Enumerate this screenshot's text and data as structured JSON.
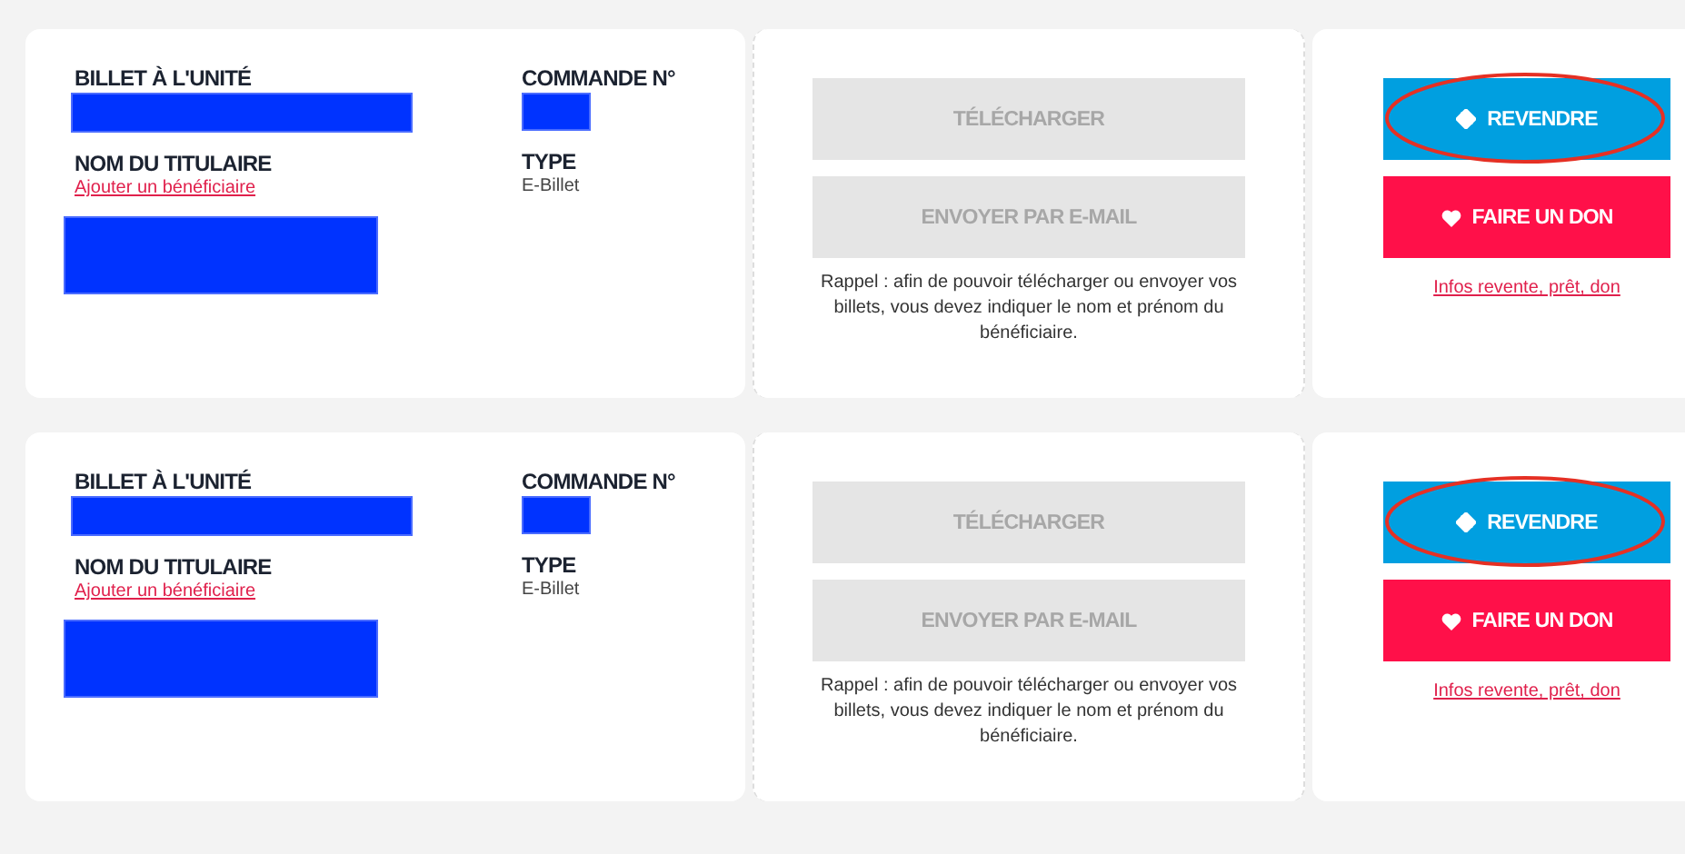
{
  "tickets": [
    {
      "columns": [
        [
          {
            "kind": "label",
            "text": "BILLET À L'UNITÉ"
          },
          {
            "kind": "redaction"
          },
          {
            "kind": "label",
            "text": "NOM DU TITULAIRE"
          },
          {
            "kind": "link",
            "text": "Ajouter un bénéficiaire"
          },
          {
            "kind": "redaction"
          }
        ],
        [
          {
            "kind": "label",
            "text": "COMMANDE N°"
          },
          {
            "kind": "redaction"
          },
          {
            "kind": "label",
            "text": "TYPE"
          },
          {
            "kind": "text",
            "text": "E-Billet"
          }
        ]
      ],
      "actions": [
        {
          "label": "TÉLÉCHARGER",
          "disabled": true
        },
        {
          "label": "ENVOYER PAR E-MAIL",
          "disabled": true
        }
      ],
      "reminder": "Rappel : afin de pouvoir télécharger ou envoyer vos billets, vous devez indiquer le nom et prénom du bénéficiaire.",
      "side_buttons": [
        {
          "kind": "resell",
          "label": "REVENDRE",
          "highlighted": true
        },
        {
          "kind": "donate",
          "label": "FAIRE UN DON",
          "highlighted": false
        }
      ],
      "info_link": "Infos revente, prêt, don"
    },
    {
      "columns": [
        [
          {
            "kind": "label",
            "text": "BILLET À L'UNITÉ"
          },
          {
            "kind": "redaction"
          },
          {
            "kind": "label",
            "text": "NOM DU TITULAIRE"
          },
          {
            "kind": "link",
            "text": "Ajouter un bénéficiaire"
          },
          {
            "kind": "redaction"
          }
        ],
        [
          {
            "kind": "label",
            "text": "COMMANDE N°"
          },
          {
            "kind": "redaction"
          },
          {
            "kind": "label",
            "text": "TYPE"
          },
          {
            "kind": "text",
            "text": "E-Billet"
          }
        ]
      ],
      "actions": [
        {
          "label": "TÉLÉCHARGER",
          "disabled": true
        },
        {
          "label": "ENVOYER PAR E-MAIL",
          "disabled": true
        }
      ],
      "reminder": "Rappel : afin de pouvoir télécharger ou envoyer vos billets, vous devez indiquer le nom et prénom du bénéficiaire.",
      "side_buttons": [
        {
          "kind": "resell",
          "label": "REVENDRE",
          "highlighted": true
        },
        {
          "kind": "donate",
          "label": "FAIRE UN DON",
          "highlighted": false
        }
      ],
      "info_link": "Infos revente, prêt, don"
    }
  ]
}
